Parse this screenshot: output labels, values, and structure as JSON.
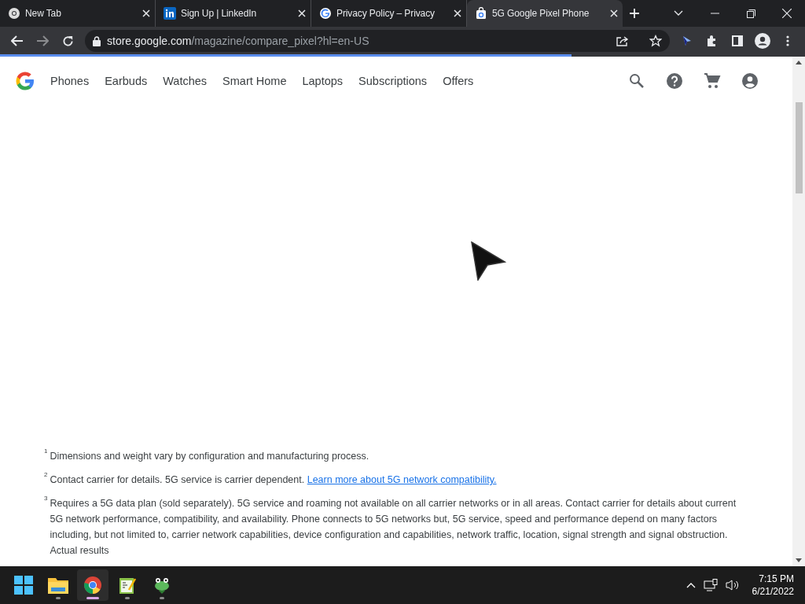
{
  "tabs": [
    {
      "title": "New Tab",
      "kind": "chrome",
      "selected": false
    },
    {
      "title": "Sign Up | LinkedIn",
      "kind": "linkedin",
      "selected": false
    },
    {
      "title": "Privacy Policy – Privacy",
      "kind": "google",
      "selected": false
    },
    {
      "title": "5G Google Pixel Phone",
      "kind": "store",
      "selected": true
    }
  ],
  "toolbar": {
    "url_host": "store.google.com",
    "url_path": "/magazine/compare_pixel?hl=en-US",
    "level": 0.71
  },
  "nav": {
    "items": [
      "Phones",
      "Earbuds",
      "Watches",
      "Smart Home",
      "Laptops",
      "Subscriptions",
      "Offers"
    ]
  },
  "footnotes": [
    {
      "mark": "1",
      "text": "Dimensions and weight vary by configuration and manufacturing process."
    },
    {
      "mark": "2",
      "text": "Contact carrier for details. 5G service is carrier dependent.",
      "link": "Learn more about 5G network compatibility."
    },
    {
      "mark": "3",
      "text": "Requires a 5G data plan (sold separately). 5G service and roaming not available on all carrier networks or in all areas. Contact carrier for details about current 5G network performance, compatibility, and availability. Phone connects to 5G networks but, 5G service, speed and performance depend on many factors including, but not limited to, carrier network capabilities, device configuration and capabilities, network traffic, location, signal strength and signal obstruction. Actual results"
    }
  ],
  "taskbar": {
    "apps": [
      {
        "kind": "start",
        "selected": false
      },
      {
        "kind": "files",
        "selected": false
      },
      {
        "kind": "chrome",
        "selected": true
      },
      {
        "kind": "notepad",
        "selected": false
      },
      {
        "kind": "frog",
        "selected": false
      }
    ],
    "time": "7:15 PM",
    "date": "6/21/2022"
  }
}
